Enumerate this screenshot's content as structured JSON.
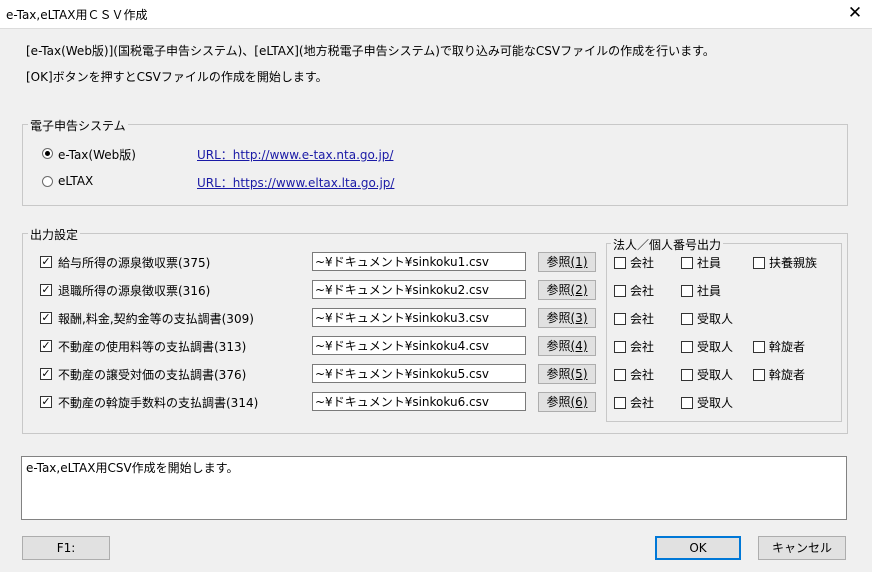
{
  "window": {
    "title": "e-Tax,eLTAX用ＣＳＶ作成",
    "close_glyph": "✕"
  },
  "description": {
    "line1": "[e-Tax(Web版)](国税電子申告システム)、[eLTAX](地方税電子申告システム)で取り込み可能なCSVファイルの作成を行います。",
    "line2": "[OK]ボタンを押すとCSVファイルの作成を開始します。"
  },
  "system_group": {
    "legend": "電子申告システム",
    "options": [
      {
        "label": "e-Tax(Web版)",
        "url": "URL：http://www.e-tax.nta.go.jp/",
        "selected": true
      },
      {
        "label": "eLTAX",
        "url": "URL：https://www.eltax.lta.go.jp/",
        "selected": false
      }
    ]
  },
  "output_group": {
    "legend": "出力設定",
    "mynumber_legend": "法人／個人番号出力",
    "rows": [
      {
        "label": "給与所得の源泉徴収票(375)",
        "checked": true,
        "path": "~¥ドキュメント¥sinkoku1.csv",
        "ref_text": "参照",
        "ref_key": "(1)",
        "opts": [
          "会社",
          "社員",
          "扶養親族"
        ]
      },
      {
        "label": "退職所得の源泉徴収票(316)",
        "checked": true,
        "path": "~¥ドキュメント¥sinkoku2.csv",
        "ref_text": "参照",
        "ref_key": "(2)",
        "opts": [
          "会社",
          "社員"
        ]
      },
      {
        "label": "報酬,料金,契約金等の支払調書(309)",
        "checked": true,
        "path": "~¥ドキュメント¥sinkoku3.csv",
        "ref_text": "参照",
        "ref_key": "(3)",
        "opts": [
          "会社",
          "受取人"
        ]
      },
      {
        "label": "不動産の使用料等の支払調書(313)",
        "checked": true,
        "path": "~¥ドキュメント¥sinkoku4.csv",
        "ref_text": "参照",
        "ref_key": "(4)",
        "opts": [
          "会社",
          "受取人",
          "斡旋者"
        ]
      },
      {
        "label": "不動産の譲受対価の支払調書(376)",
        "checked": true,
        "path": "~¥ドキュメント¥sinkoku5.csv",
        "ref_text": "参照",
        "ref_key": "(5)",
        "opts": [
          "会社",
          "受取人",
          "斡旋者"
        ]
      },
      {
        "label": "不動産の斡旋手数料の支払調書(314)",
        "checked": true,
        "path": "~¥ドキュメント¥sinkoku6.csv",
        "ref_text": "参照",
        "ref_key": "(6)",
        "opts": [
          "会社",
          "受取人"
        ]
      }
    ]
  },
  "status": {
    "message": "e-Tax,eLTAX用CSV作成を開始します。"
  },
  "buttons": {
    "f1": "F1:",
    "ok": "OK",
    "cancel": "キャンセル"
  }
}
